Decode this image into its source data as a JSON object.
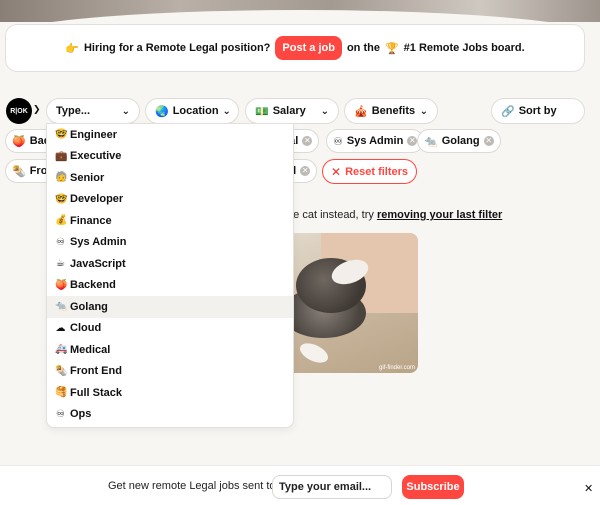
{
  "banner": {
    "icon": "👉",
    "text": "Hiring for a Remote Legal position?",
    "cta": "Post a job",
    "suffix_before": "on the",
    "trophy": "🏆",
    "suffix_after": "#1 Remote Jobs board."
  },
  "logo": {
    "text": "R|OK"
  },
  "filters": {
    "type": {
      "label": "Type...",
      "icon": ""
    },
    "location": {
      "label": "Location",
      "icon": "🌏"
    },
    "salary": {
      "label": "Salary",
      "icon": "💵"
    },
    "benefits": {
      "label": "Benefits",
      "icon": "🎪"
    },
    "sort": {
      "label": "Sort by",
      "icon": "🔗"
    }
  },
  "chips": [
    {
      "icon": "🍑",
      "label": "Back"
    },
    {
      "icon": "",
      "label": "cal"
    },
    {
      "icon": "♾",
      "label": "Sys Admin"
    },
    {
      "icon": "🐀",
      "label": "Golang"
    },
    {
      "icon": "🌯",
      "label": "Front"
    },
    {
      "icon": "",
      "label": "al"
    }
  ],
  "reset": {
    "label": "Reset filters",
    "icon": "✕"
  },
  "empty_state": {
    "text": "ute cat instead, try",
    "link": "removing your last filter"
  },
  "gif": {
    "watermark": "gif-finder.com"
  },
  "type_options": [
    {
      "icon": "🤓",
      "label": "Engineer"
    },
    {
      "icon": "💼",
      "label": "Executive"
    },
    {
      "icon": "🧓",
      "label": "Senior"
    },
    {
      "icon": "🤓",
      "label": "Developer"
    },
    {
      "icon": "💰",
      "label": "Finance"
    },
    {
      "icon": "♾",
      "label": "Sys Admin"
    },
    {
      "icon": "☕",
      "label": "JavaScript"
    },
    {
      "icon": "🍑",
      "label": "Backend"
    },
    {
      "icon": "🐀",
      "label": "Golang"
    },
    {
      "icon": "☁",
      "label": "Cloud"
    },
    {
      "icon": "🚑",
      "label": "Medical"
    },
    {
      "icon": "🌯",
      "label": "Front End"
    },
    {
      "icon": "🥞",
      "label": "Full Stack"
    },
    {
      "icon": "♾",
      "label": "Ops"
    }
  ],
  "footer": {
    "label": "Get new remote Legal jobs sent to",
    "placeholder": "Type your email...",
    "subscribe": "Subscribe",
    "close": "✕"
  },
  "colors": {
    "accent": "#ff4742",
    "background": "#f8f6f3"
  }
}
